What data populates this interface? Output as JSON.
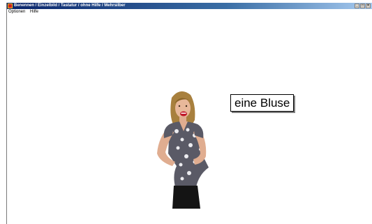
{
  "window": {
    "title": "Benennen / Einzelbild / Tastatur / ohne Hilfe / Mehrsilber",
    "controls": [
      "minimize",
      "maximize",
      "close"
    ]
  },
  "menu": {
    "items": [
      {
        "label": "Optionen"
      },
      {
        "label": "Hilfe"
      }
    ]
  },
  "exercise": {
    "word": "eine Bluse",
    "image": "woman-in-blouse-icon"
  },
  "colors": {
    "titlebar_start": "#0a246a",
    "titlebar_end": "#a6caf0"
  }
}
